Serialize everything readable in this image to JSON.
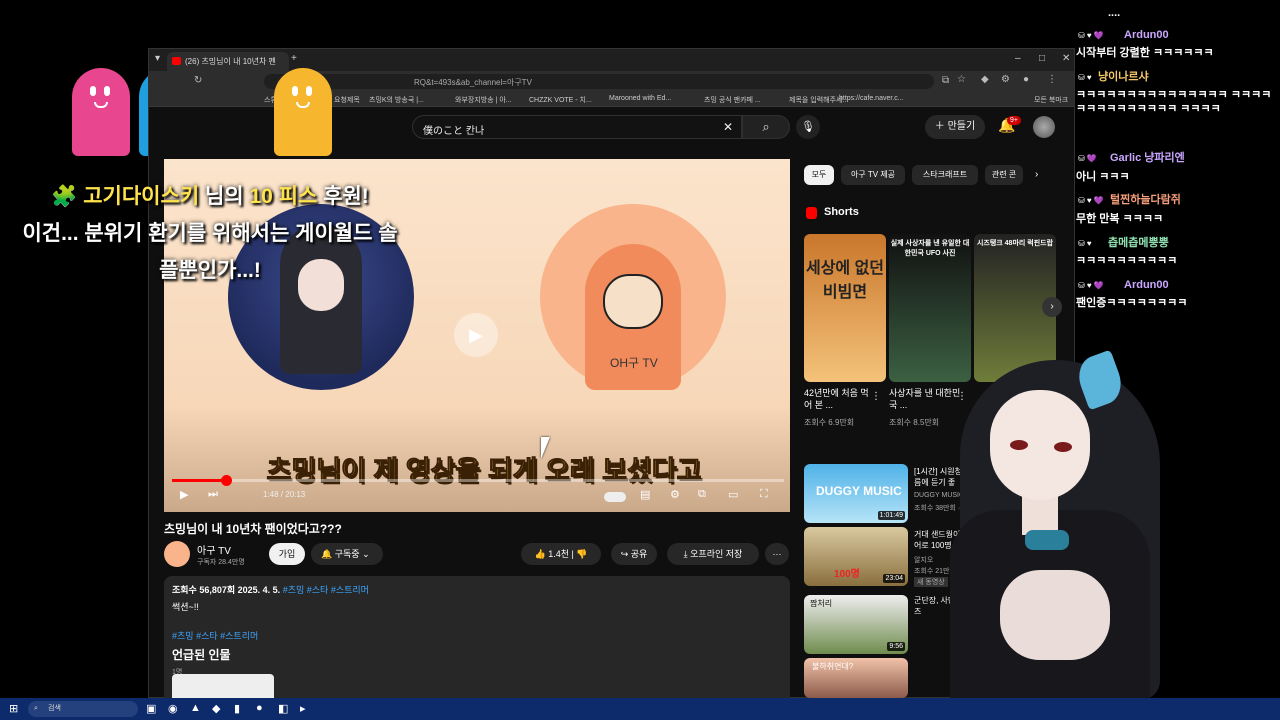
{
  "overlay": {
    "donation_donor": "고기다이스키",
    "donation_mid": " 님의 ",
    "donation_amount": "10 피스",
    "donation_tail": " 후원!",
    "donation_message": "이건... 분위기 환기를 위해서는 게이월드 솔플뿐인가...!",
    "ghost_colors": [
      "#e8468f",
      "#1f9ee0",
      "#2fc46e",
      "#f6b62e"
    ]
  },
  "browser": {
    "tab_title": "(26) 츠밍님이 내 10년차 펜",
    "url": "RQ&t=493s&ab_channel=아구TV",
    "bookmarks": [
      "스튜",
      "요청제목",
      "츠밍K의 방송국 |...",
      "와부장지방송 | 아...",
      "CHZZK VOTE - 치...",
      "Marooned with Ed...",
      "츠밍 공식 팬카페 ...",
      "제목을 입력해주세...",
      "https://cafe.naver.c...",
      "모든 북마크"
    ]
  },
  "youtube": {
    "search_query": "僕のこと 칸나",
    "create_label": "만들기",
    "notif_count": "9+",
    "player": {
      "subtitle": "츠밍님이 제 영상을 되게 오래 보셨다고",
      "time": "1:48 / 20:13",
      "progress": 0.089,
      "channel_logo": "OH구 TV"
    },
    "video": {
      "title": "츠밍님이 내 10년차 팬이었다고???",
      "channel": "아구 TV",
      "subscribers": "구독자 28.4만명",
      "join": "가입",
      "subscribed": "구독중",
      "likes": "1.4천",
      "share": "공유",
      "download": "오프라인 저장",
      "more": "···"
    },
    "description": {
      "meta": "조회수 56,807회  2025. 4. 5.",
      "meta_tags": "#츠밍 #스타 #스트리머",
      "text": "썩션~!!",
      "tags": "#츠밍 #스타 #스트리머",
      "section": "언급된 인물",
      "count": "1명"
    },
    "chips": [
      "모두",
      "아구 TV 제공",
      "스타크래프트",
      "관련 콘"
    ],
    "shorts_label": "Shorts",
    "shorts": [
      {
        "caption": "세상에 없던 비빔면",
        "title": "42년만에 처음 먹어 본 ...",
        "views": "조회수 6.9만회"
      },
      {
        "caption": "실제 사상자를 낸 유일한 대한민국 UFO 사진",
        "title": "사상자를 낸 대한민국 ...",
        "views": "조회수 8.5만회"
      },
      {
        "caption": "시즈탱크 48마리 럭핀드랍",
        "title": "",
        "views": ""
      }
    ],
    "recommended": [
      {
        "title": "[1시간] 시원청량 음 | 여름에 듣기 좋",
        "channel": "DUGGY MUSIC",
        "meta": "조회수 38만회 · 1 개",
        "duration": "1:01:49",
        "thumb": "DUGGY MUSIC"
      },
      {
        "title": "거대 샌드웜이 시 드코어로 100명",
        "channel": "알지오",
        "meta": "조회수 21만회",
        "badge": "새 동영상",
        "duration": "23:04",
        "thumb": "100명"
      },
      {
        "title": "군단장, 사단 야식인데 즈",
        "channel": "",
        "meta": "",
        "duration": "9:56",
        "thumb": "짬처리"
      },
      {
        "title": "",
        "channel": "",
        "meta": "",
        "duration": "",
        "thumb": "불하취면대?"
      }
    ]
  },
  "chat": [
    {
      "name": "",
      "message": "...."
    },
    {
      "name": "Ardun00",
      "message": "시작부터 강렬한 ㅋㅋㅋㅋㅋㅋ"
    },
    {
      "name": "냥이나르샤",
      "message": "ㅋㅋㅋㅋㅋㅋㅋㅋㅋㅋㅋㅋㅋㅋㅋ ㅋㅋㅋㅋㅋㅋㅋㅋㅋㅋㅋㅋㅋㅋ ㅋㅋㅋㅋ"
    },
    {
      "name": "Garlic 냥파리엔",
      "message": "아니 ㅋㅋㅋ"
    },
    {
      "name": "털찐하늘다람쥐",
      "message": "무한 만복 ㅋㅋㅋㅋ"
    },
    {
      "name": "츱메츱메뿡뿡",
      "message": "ㅋㅋㅋㅋㅋㅋㅋㅋㅋㅋ"
    },
    {
      "name": "Ardun00",
      "message": "팬인증ㅋㅋㅋㅋㅋㅋㅋㅋ"
    }
  ],
  "taskbar": {
    "search_placeholder": "검색"
  }
}
